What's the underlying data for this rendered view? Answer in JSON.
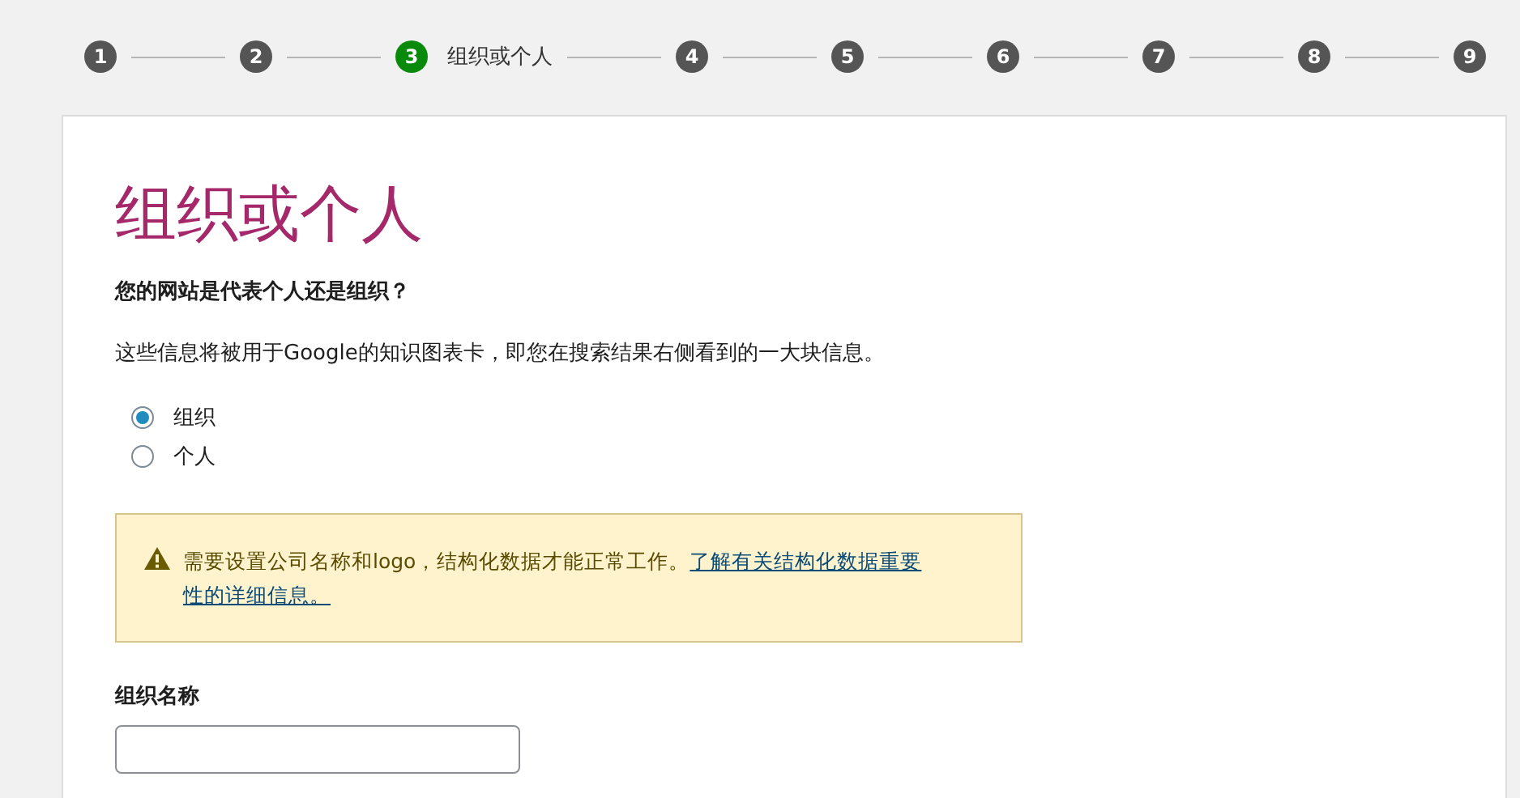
{
  "steps": [
    {
      "number": "1",
      "selected": false
    },
    {
      "number": "2",
      "selected": false
    },
    {
      "number": "3",
      "label": "组织或个人",
      "selected": true
    },
    {
      "number": "4",
      "selected": false
    },
    {
      "number": "5",
      "selected": false
    },
    {
      "number": "6",
      "selected": false
    },
    {
      "number": "7",
      "selected": false
    },
    {
      "number": "8",
      "selected": false
    },
    {
      "number": "9",
      "selected": false
    }
  ],
  "title": "组织或个人",
  "question": "您的网站是代表个人还是组织？",
  "description": "这些信息将被用于Google的知识图表卡，即您在搜索结果右侧看到的一大块信息。",
  "options": [
    {
      "label": "组织",
      "selected": true
    },
    {
      "label": "个人",
      "selected": false
    }
  ],
  "alert": {
    "text": "需要设置公司名称和logo，结构化数据才能正常工作。",
    "link_lines": [
      "了解有关结构化数据重要",
      "性的详细信息。"
    ]
  },
  "field": {
    "label": "组织名称"
  }
}
